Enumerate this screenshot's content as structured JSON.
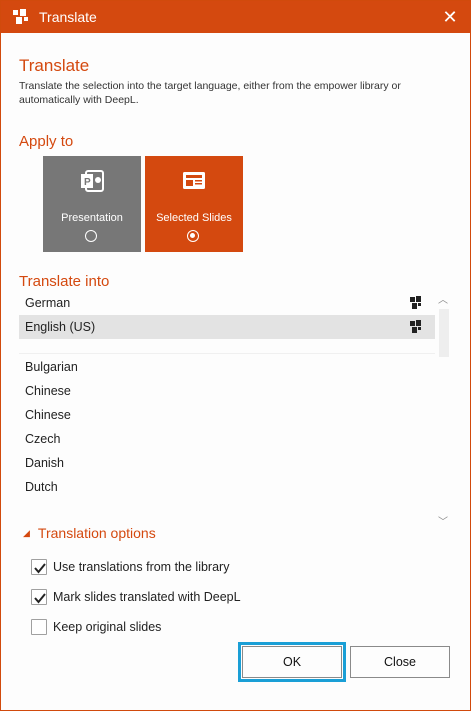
{
  "window": {
    "title": "Translate",
    "close_glyph": "✕",
    "accent_color": "#d4490f"
  },
  "header": {
    "title": "Translate",
    "description": "Translate the selection into the target language, either from the empower library or automatically with DeepL."
  },
  "apply_to": {
    "title": "Apply to",
    "options": [
      {
        "label": "Presentation",
        "icon": "powerpoint-icon",
        "selected": false
      },
      {
        "label": "Selected Slides",
        "icon": "slides-icon",
        "selected": true
      }
    ]
  },
  "translate_into": {
    "title": "Translate into",
    "favorites": [
      {
        "label": "German",
        "deepl": true,
        "selected": false
      },
      {
        "label": "English (US)",
        "deepl": true,
        "selected": true
      }
    ],
    "languages": [
      "Bulgarian",
      "Chinese",
      "Chinese",
      "Czech",
      "Danish",
      "Dutch"
    ]
  },
  "options": {
    "title": "Translation options",
    "items": [
      {
        "label": "Use translations from the library",
        "checked": true
      },
      {
        "label": "Mark slides translated with DeepL",
        "checked": true
      },
      {
        "label": "Keep original slides",
        "checked": false
      }
    ]
  },
  "buttons": {
    "ok": "OK",
    "close": "Close"
  }
}
